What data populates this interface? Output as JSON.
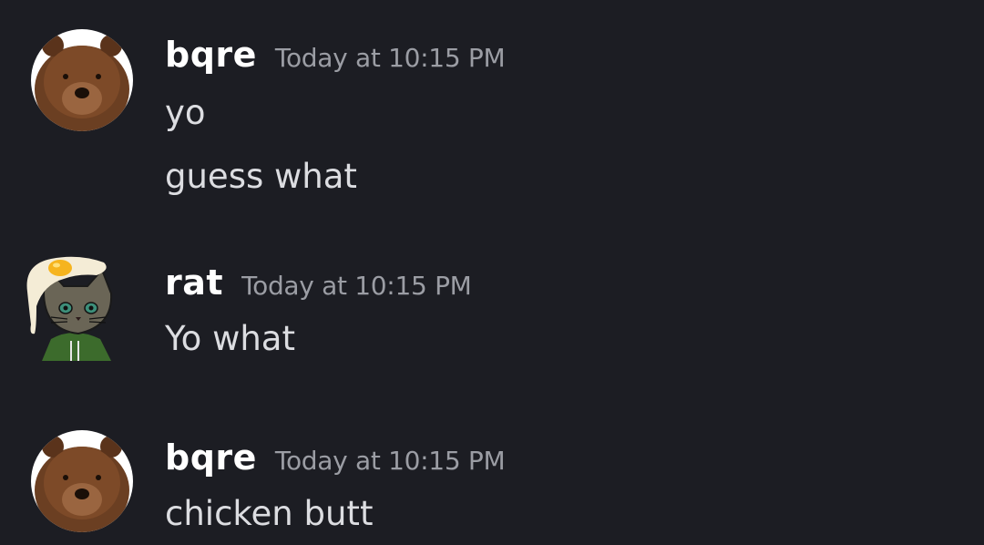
{
  "messages": [
    {
      "username": "bqre",
      "timestamp": "Today at 10:15 PM",
      "avatar_icon": "bear-avatar-icon",
      "lines": [
        "yo",
        "guess what"
      ]
    },
    {
      "username": "rat",
      "timestamp": "Today at 10:15 PM",
      "avatar_icon": "cat-with-egg-avatar-icon",
      "lines": [
        "Yo what"
      ]
    },
    {
      "username": "bqre",
      "timestamp": "Today at 10:15 PM",
      "avatar_icon": "bear-avatar-icon",
      "lines": [
        "chicken butt"
      ]
    }
  ],
  "colors": {
    "background": "#1c1d23",
    "username": "#ffffff",
    "timestamp": "#9b9da4",
    "message_text": "#dcdde1"
  }
}
